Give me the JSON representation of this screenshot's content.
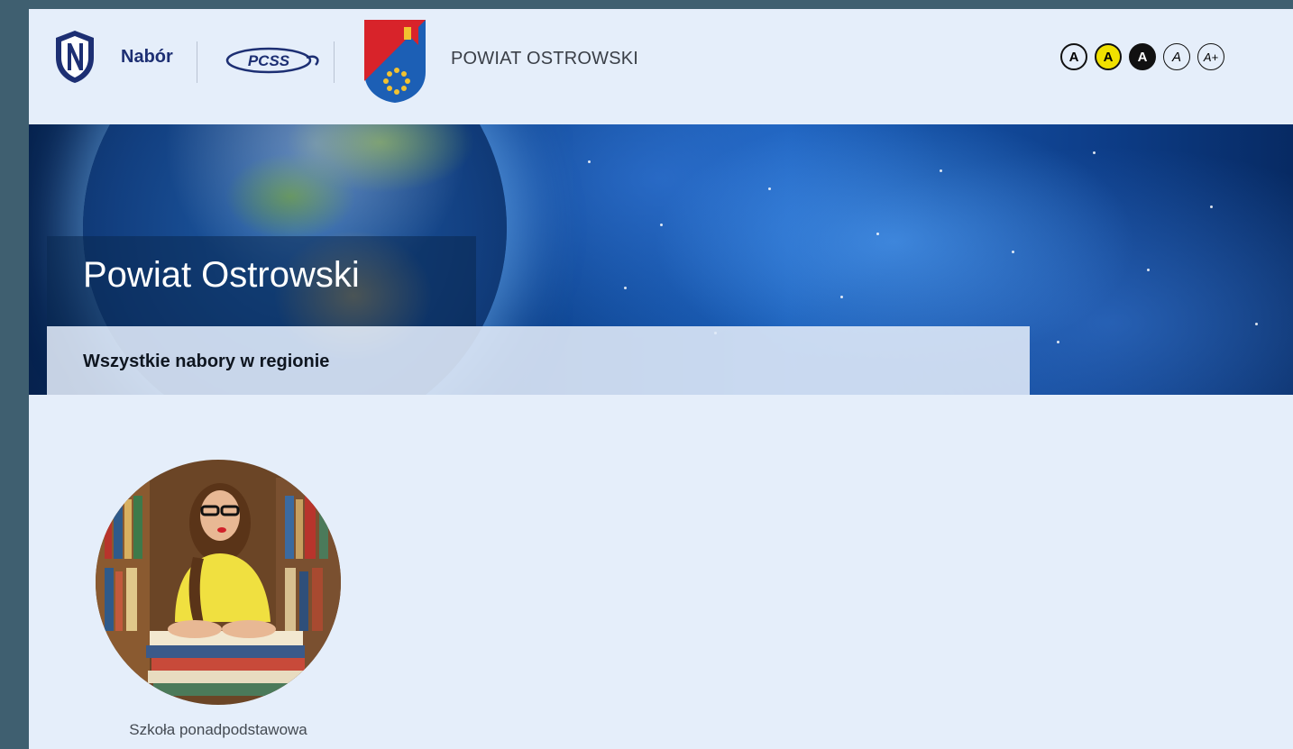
{
  "header": {
    "brand_name": "Nabór",
    "partner_logo_text": "PCSS",
    "region_name": "POWIAT OSTROWSKI",
    "accessibility": [
      {
        "label": "A",
        "name": "contrast-default-button"
      },
      {
        "label": "A",
        "name": "contrast-yellow-button"
      },
      {
        "label": "A",
        "name": "contrast-dark-button"
      },
      {
        "label": "A",
        "name": "font-default-button"
      },
      {
        "label": "A+",
        "name": "font-larger-button"
      }
    ]
  },
  "banner": {
    "title": "Powiat Ostrowski",
    "subtitle": "Wszystkie nabory w regionie"
  },
  "tiles": [
    {
      "label": "Szkoła ponadpodstawowa",
      "image": "student-with-books-photo"
    }
  ],
  "colors": {
    "page_background": "#e5eefa",
    "outer_background": "#3f5f70",
    "brand_navy": "#1d2f73",
    "contrast_yellow": "#f0e000"
  }
}
